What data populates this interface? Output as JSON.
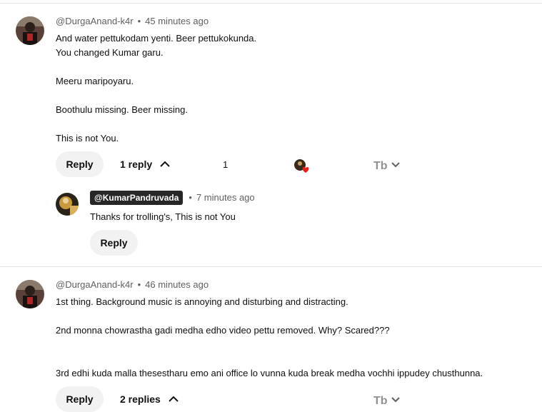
{
  "comments": [
    {
      "handle": "@DurgaAnand-k4r",
      "time": "45 minutes ago",
      "lines": [
        "And water pettukodam yenti. Beer pettukokunda.",
        "You changed Kumar garu.",
        "",
        "Meeru maripoyaru.",
        "",
        "Boothulu missing. Beer missing.",
        "",
        "This is not You."
      ],
      "reply_label": "Reply",
      "replies_label": "1 reply",
      "like_count": "1",
      "reply": {
        "handle": "@KumarPandruvada",
        "time": "7 minutes ago",
        "text": "Thanks for trolling's, This is not You",
        "reply_label": "Reply"
      }
    },
    {
      "handle": "@DurgaAnand-k4r",
      "time": "46 minutes ago",
      "lines": [
        "1st thing. Background music is annoying and disturbing and distracting.",
        "",
        "2nd monna chowrastha gadi medha edho video pettu removed. Why?  Scared???",
        "",
        "",
        "3rd edhi kuda malla thesestharu emo ani office lo vunna kuda break medha vochhi ippudey chusthunna."
      ],
      "reply_label": "Reply",
      "replies_label": "2 replies"
    }
  ],
  "colors": {
    "heart": "#e62117",
    "chip_bg": "#272727",
    "pill_bg": "#f2f2f2",
    "meta": "#606060"
  },
  "icons": [
    "chevron-up-icon",
    "heart-icon",
    "translate-icon",
    "chevron-down-icon"
  ]
}
